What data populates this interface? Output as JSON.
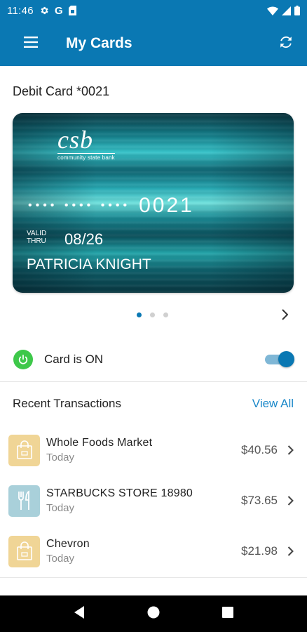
{
  "status_bar": {
    "time": "11:46",
    "icons": [
      "gear-icon",
      "google-icon",
      "sim-card-icon"
    ],
    "right_icons": [
      "wifi-icon",
      "signal-icon",
      "battery-icon"
    ]
  },
  "app_bar": {
    "title": "My Cards",
    "menu_icon": "hamburger-menu-icon",
    "refresh_icon": "refresh-icon",
    "background": "#0a78b3"
  },
  "card_section": {
    "heading": "Debit Card *0021",
    "card": {
      "logo": "csb",
      "logo_subtitle": "community state bank",
      "masked_groups": "•••• •••• ••••",
      "last4": "0021",
      "valid_thru_label_1": "VALID",
      "valid_thru_label_2": "THRU",
      "expiry": "08/26",
      "cardholder": "PATRICIA KNIGHT"
    },
    "pager": {
      "count": 3,
      "active_index": 0
    }
  },
  "card_status": {
    "label": "Card is ON",
    "enabled": true,
    "status_color": "#3ec84a"
  },
  "transactions": {
    "heading": "Recent Transactions",
    "view_all": "View All",
    "items": [
      {
        "merchant": "Whole Foods Market",
        "date": "Today",
        "amount": "$40.56",
        "icon": "shopping-bag-icon"
      },
      {
        "merchant": "STARBUCKS STORE 18980",
        "date": "Today",
        "amount": "$73.65",
        "icon": "fork-knife-icon"
      },
      {
        "merchant": "Chevron",
        "date": "Today",
        "amount": "$21.98",
        "icon": "shopping-bag-icon"
      }
    ]
  },
  "nav_bar": {
    "buttons": [
      "back-icon",
      "home-icon",
      "recents-icon"
    ]
  }
}
